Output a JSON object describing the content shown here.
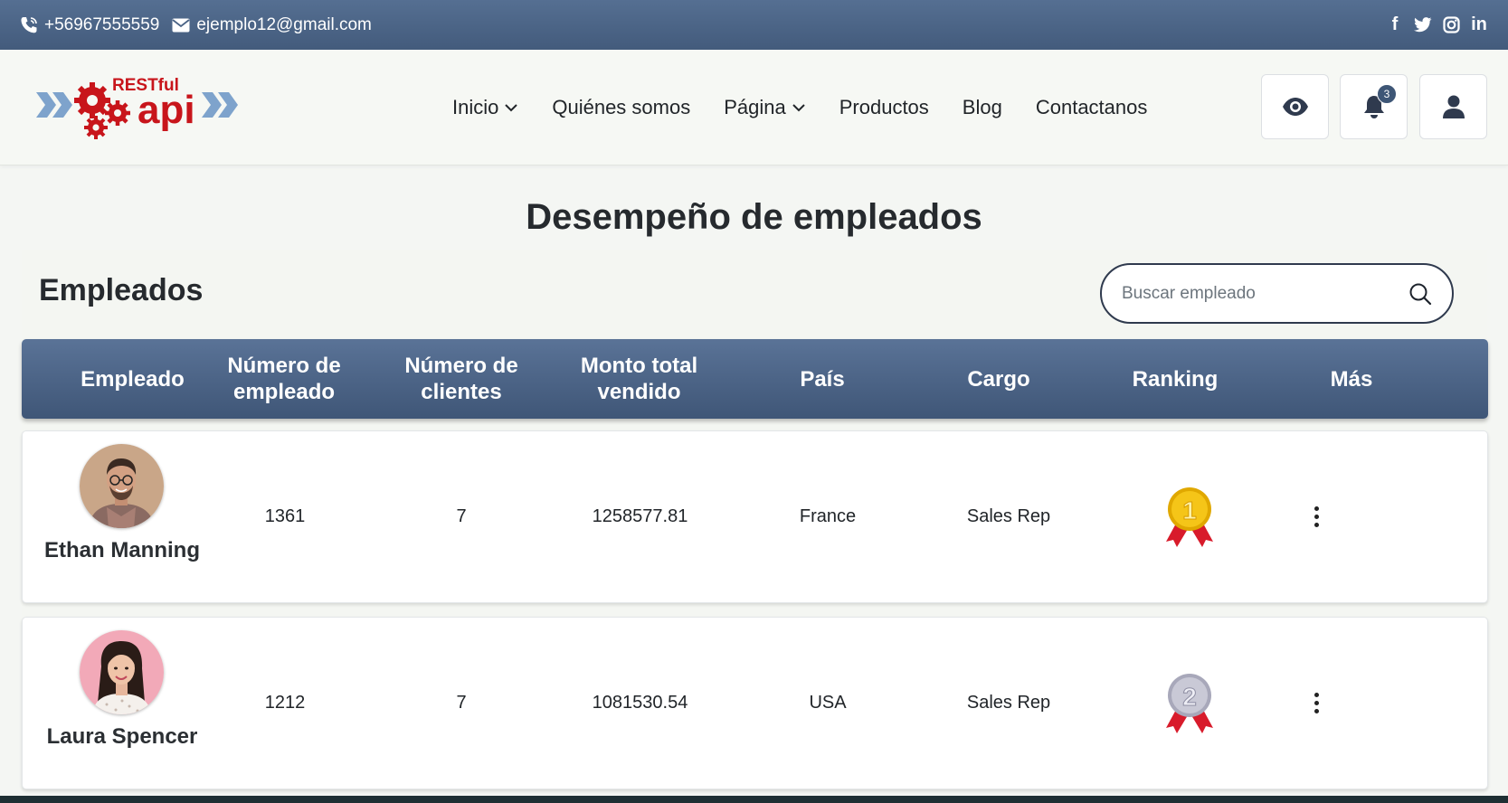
{
  "topbar": {
    "phone": "+56967555559",
    "email": "ejemplo12@gmail.com",
    "socials": [
      {
        "icon": "facebook-icon",
        "glyph": "f"
      },
      {
        "icon": "twitter-icon",
        "glyph": ""
      },
      {
        "icon": "instagram-icon",
        "glyph": ""
      },
      {
        "icon": "linkedin-icon",
        "glyph": "in"
      }
    ]
  },
  "logo": {
    "top_text": "RESTful",
    "bottom_text": "api"
  },
  "nav": {
    "items": [
      {
        "label": "Inicio",
        "dropdown": true
      },
      {
        "label": "Quiénes somos",
        "dropdown": false
      },
      {
        "label": "Página",
        "dropdown": true
      },
      {
        "label": "Productos",
        "dropdown": false
      },
      {
        "label": "Blog",
        "dropdown": false
      },
      {
        "label": "Contactanos",
        "dropdown": false
      }
    ],
    "notifications_count": "3"
  },
  "page": {
    "title": "Desempeño de empleados"
  },
  "panel": {
    "title": "Empleados",
    "search_placeholder": "Buscar empleado"
  },
  "table": {
    "headers": [
      "Empleado",
      "Número de empleado",
      "Número de clientes",
      "Monto total vendido",
      "País",
      "Cargo",
      "Ranking",
      "Más"
    ],
    "rows": [
      {
        "name": "Ethan Manning",
        "number": "1361",
        "clients": "7",
        "total": "1258577.81",
        "country": "France",
        "role": "Sales Rep",
        "rank": "1",
        "medal": "gold"
      },
      {
        "name": "Laura Spencer",
        "number": "1212",
        "clients": "7",
        "total": "1081530.54",
        "country": "USA",
        "role": "Sales Rep",
        "rank": "2",
        "medal": "silver"
      }
    ]
  },
  "colors": {
    "header_blue": "#435b7c",
    "logo_red": "#c8151b",
    "logo_arrows": "#7ea3cc",
    "gold": "#f5c518",
    "silver": "#c9c9d6",
    "ribbon": "#d81b2b"
  }
}
